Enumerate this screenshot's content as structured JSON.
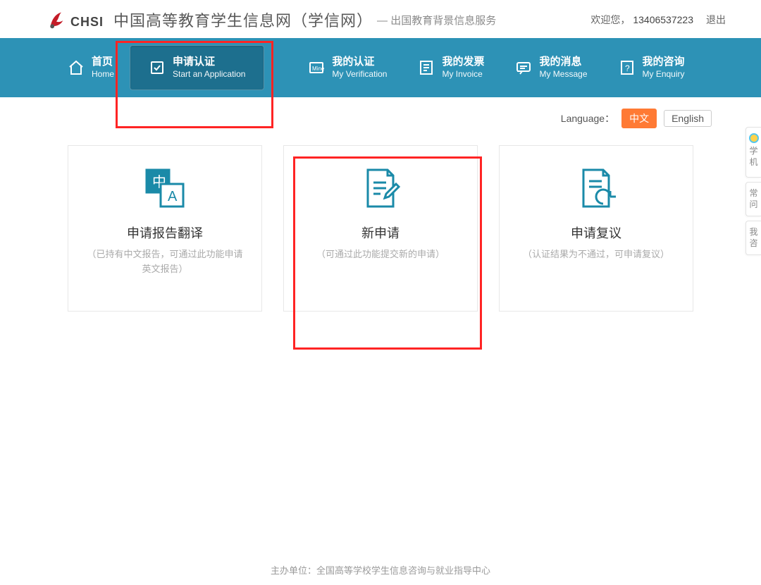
{
  "header": {
    "logo_text": "CHSI",
    "site_title": "中国高等教育学生信息网（学信网）",
    "site_sub": "— 出国教育背景信息服务",
    "welcome": "欢迎您，",
    "phone": "13406537223",
    "logout": "退出"
  },
  "nav": [
    {
      "cn": "首页",
      "en": "Home"
    },
    {
      "cn": "申请认证",
      "en": "Start an Application"
    },
    {
      "cn": "我的认证",
      "en": "My Verification"
    },
    {
      "cn": "我的发票",
      "en": "My Invoice"
    },
    {
      "cn": "我的消息",
      "en": "My Message"
    },
    {
      "cn": "我的咨询",
      "en": "My Enquiry"
    }
  ],
  "lang": {
    "label": "Language：",
    "zh": "中文",
    "en": "English"
  },
  "cards": [
    {
      "title": "申请报告翻译",
      "desc": "（已持有中文报告，可通过此功能申请英文报告）"
    },
    {
      "title": "新申请",
      "desc": "（可通过此功能提交新的申请）"
    },
    {
      "title": "申请复议",
      "desc": "（认证结果为不通过，可申请复议）"
    }
  ],
  "side_tabs": {
    "t1a": "学",
    "t1b": "机",
    "t2a": "常",
    "t2b": "问",
    "t3a": "我",
    "t3b": "咨"
  },
  "footer": {
    "line1": "主办单位：全国高等学校学生信息咨询与就业指导中心"
  }
}
